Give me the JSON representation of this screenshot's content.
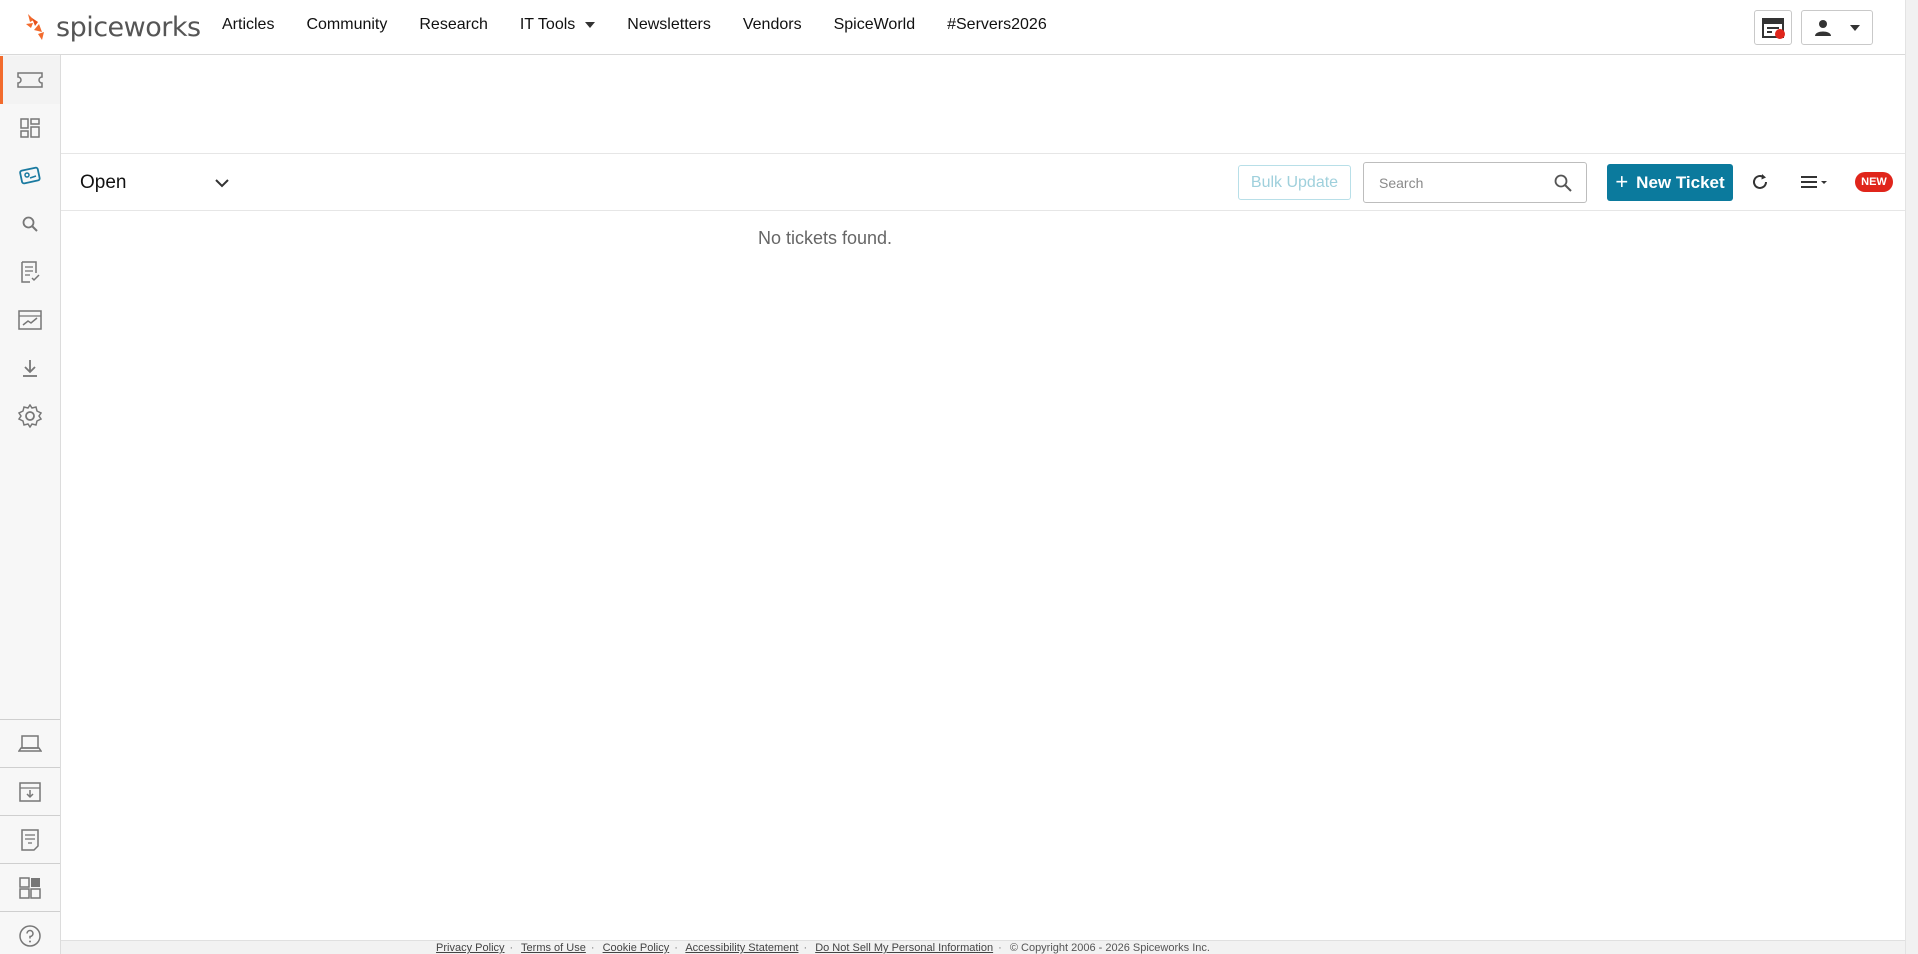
{
  "brand": {
    "name": "spiceworks",
    "accent": "#f26b2d"
  },
  "nav": {
    "items": [
      {
        "label": "Articles"
      },
      {
        "label": "Community"
      },
      {
        "label": "Research"
      },
      {
        "label": "IT Tools",
        "dropdown": true
      },
      {
        "label": "Newsletters"
      },
      {
        "label": "Vendors"
      },
      {
        "label": "SpiceWorld"
      },
      {
        "label": "#Servers2026"
      }
    ]
  },
  "header_buttons": {
    "widgets_icon": "layout-panel-icon",
    "user_icon": "person-icon",
    "notification_color": "#e0251b"
  },
  "sidebar": {
    "top_items": [
      {
        "icon": "ticket-icon",
        "active": true
      },
      {
        "icon": "dashboard-icon"
      },
      {
        "icon": "tickets-tag-icon"
      },
      {
        "icon": "search-icon"
      },
      {
        "icon": "checklist-icon"
      },
      {
        "icon": "reports-icon"
      },
      {
        "icon": "download-icon"
      },
      {
        "icon": "gear-icon"
      }
    ],
    "bottom_items": [
      {
        "icon": "laptop-icon"
      },
      {
        "icon": "inbox-download-icon"
      },
      {
        "icon": "document-icon"
      },
      {
        "icon": "apps-grid-icon"
      },
      {
        "icon": "help-icon"
      }
    ]
  },
  "toolbar": {
    "filter_label": "Open",
    "bulk_update_label": "Bulk Update",
    "search_placeholder": "Search",
    "new_ticket_label": "New Ticket",
    "new_badge": "NEW",
    "primary_color": "#0b7a9d"
  },
  "main": {
    "empty_message": "No tickets found."
  },
  "footer": {
    "links": [
      "Privacy Policy",
      "Terms of Use",
      "Cookie Policy",
      "Accessibility Statement",
      "Do Not Sell My Personal Information"
    ],
    "copyright": "© Copyright 2006 - 2026 Spiceworks Inc."
  }
}
